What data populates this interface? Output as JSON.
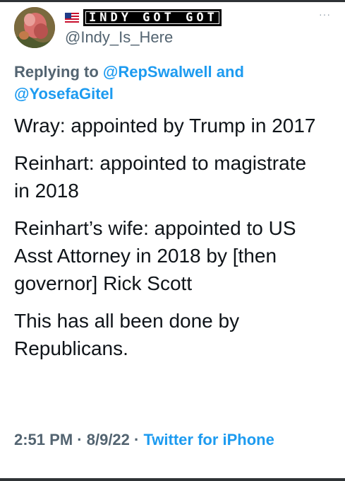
{
  "colors": {
    "link": "#1d9bf0",
    "secondary_text": "#536471",
    "primary_text": "#0f1419",
    "frame": "#2f3336"
  },
  "author": {
    "flag_icon": "us-flag-icon",
    "display_name": "INDY GOT GOT",
    "handle": "@Indy_Is_Here",
    "more_icon": "···"
  },
  "reply_context": {
    "prefix": "Replying to",
    "user1": "@RepSwalwell",
    "joiner": "and",
    "user2": "@YosefaGitel"
  },
  "tweet": {
    "paragraphs": [
      "Wray: appointed by Trump in 2017",
      "Reinhart: appointed to magistrate in 2018",
      "Reinhart’s wife: appointed to US Asst Attorney in 2018 by [then governor] Rick Scott",
      "This has all been done by Republicans."
    ]
  },
  "meta": {
    "time": "2:51 PM",
    "separator": "·",
    "date": "8/9/22",
    "source": "Twitter for iPhone"
  }
}
